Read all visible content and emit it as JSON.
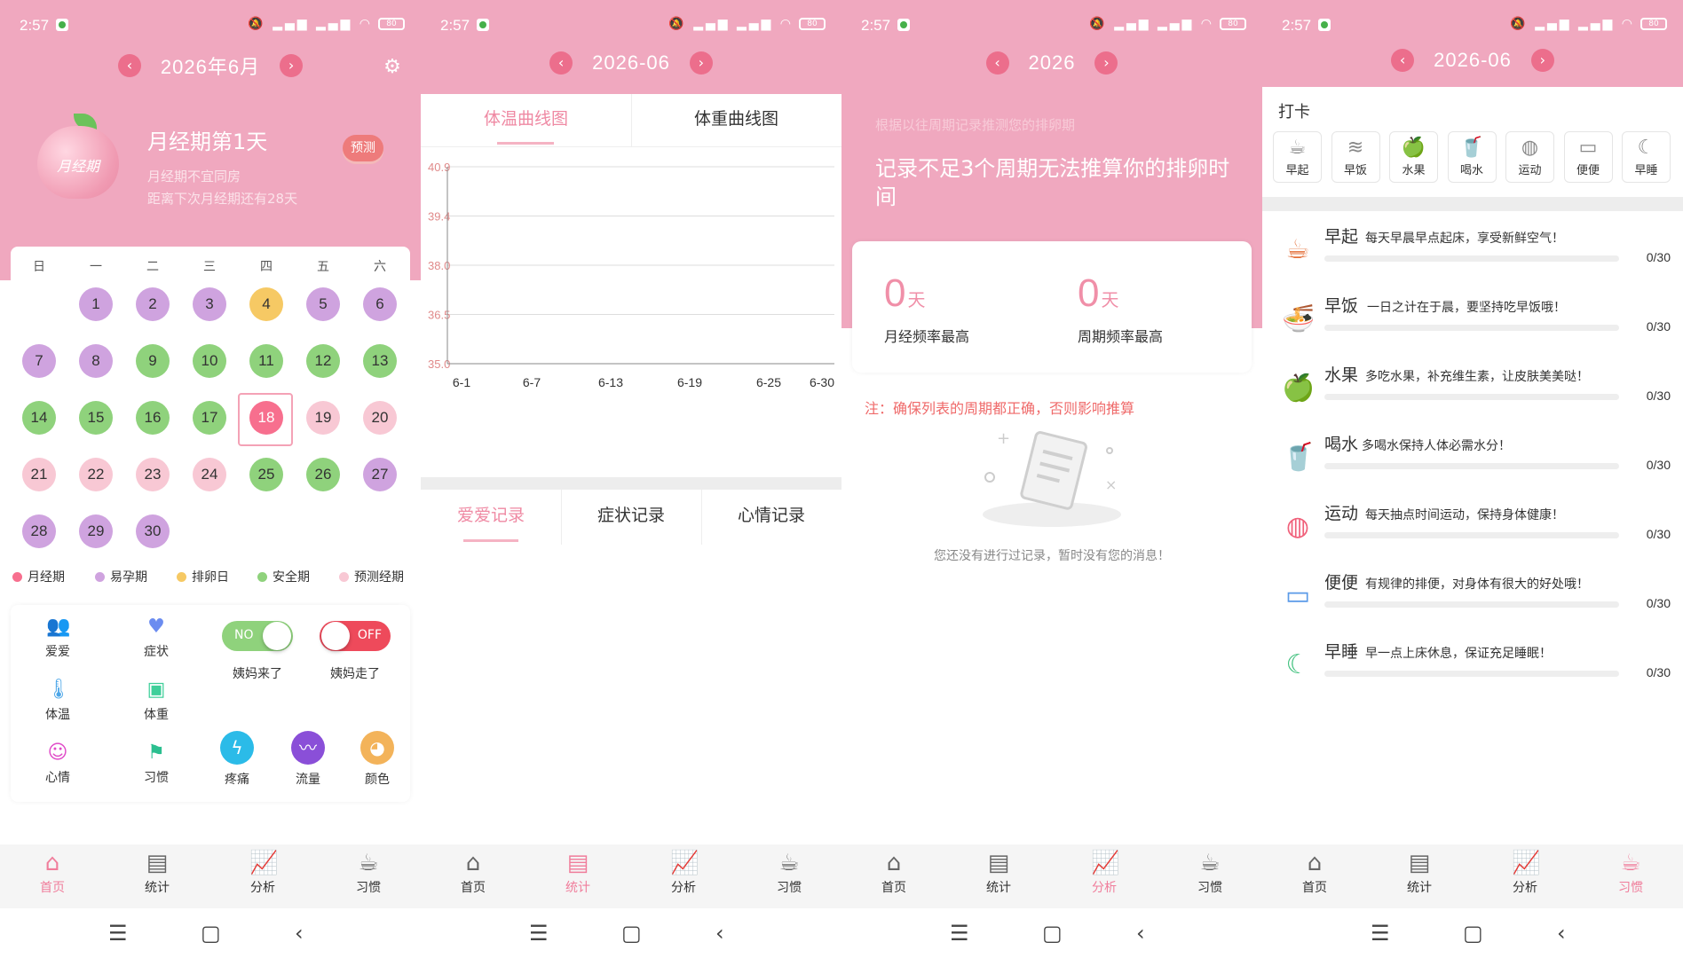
{
  "status": {
    "time": "2:57",
    "battery": "80"
  },
  "p1": {
    "month": "2026年6月",
    "apple_label": "月经期",
    "phase": "月经期第1天",
    "tip1": "月经期不宜同房",
    "tip2": "距离下次月经期还有28天",
    "predict": "预测",
    "weekdays": [
      "日",
      "一",
      "二",
      "三",
      "四",
      "五",
      "六"
    ],
    "days": [
      "1",
      "2",
      "3",
      "4",
      "5",
      "6",
      "7",
      "8",
      "9",
      "10",
      "11",
      "12",
      "13",
      "14",
      "15",
      "16",
      "17",
      "18",
      "19",
      "20",
      "21",
      "22",
      "23",
      "24",
      "25",
      "26",
      "27",
      "28",
      "29",
      "30"
    ],
    "legend": [
      "月经期",
      "易孕期",
      "排卵日",
      "安全期",
      "预测经期"
    ],
    "colors": {
      "mens": "#f76f8e",
      "fert": "#cfa3df",
      "ovu": "#f6c964",
      "safe": "#8fd27c",
      "pred": "#f8c8d4"
    },
    "tools": {
      "love": "爱爱",
      "symptom": "症状",
      "temp": "体温",
      "weight": "体重",
      "mood": "心情",
      "habit": "习惯",
      "pain": "疼痛",
      "flow": "流量",
      "color": "颜色"
    },
    "toggle_on": {
      "text": "NO",
      "label": "姨妈来了"
    },
    "toggle_off": {
      "text": "OFF",
      "label": "姨妈走了"
    }
  },
  "p2": {
    "month": "2026-06",
    "tab_temp": "体温曲线图",
    "tab_weight": "体重曲线图",
    "tab_love": "爱爱记录",
    "tab_symptom": "症状记录",
    "tab_mood": "心情记录"
  },
  "chart_data": {
    "type": "line",
    "title": "",
    "xlabel": "",
    "ylabel": "",
    "x": [
      "6-1",
      "6-7",
      "6-13",
      "6-19",
      "6-25",
      "6-30"
    ],
    "y_ticks": [
      "40.9",
      "39.4",
      "38.0",
      "36.5",
      "35.0"
    ],
    "ylim": [
      35.0,
      40.9
    ],
    "series": [],
    "grid": true
  },
  "p3": {
    "year": "2026",
    "hint": "根据以往周期记录推测您的排卵期",
    "message": "记录不足3个周期无法推算你的排卵时间",
    "stat1": {
      "num": "0",
      "unit": "天",
      "label": "月经频率最高"
    },
    "stat2": {
      "num": "0",
      "unit": "天",
      "label": "周期频率最高"
    },
    "note": "注：确保列表的周期都正确，否则影响推算",
    "empty": "您还没有进行过记录，暂时没有您的消息！"
  },
  "p4": {
    "month": "2026-06",
    "checkin_title": "打卡",
    "quick": [
      "早起",
      "早饭",
      "水果",
      "喝水",
      "运动",
      "便便",
      "早睡"
    ],
    "habits": [
      {
        "title": "早起",
        "desc": "每天早晨早点起床，享受新鲜空气！",
        "count": "0/30",
        "progress": 0
      },
      {
        "title": "早饭",
        "desc": "一日之计在于晨，要坚持吃早饭哦！",
        "count": "0/30",
        "progress": 0
      },
      {
        "title": "水果",
        "desc": "多吃水果，补充维生素，让皮肤美美哒！",
        "count": "0/30",
        "progress": 0
      },
      {
        "title": "喝水",
        "desc": "多喝水保持人体必需水分！",
        "count": "0/30",
        "progress": 0
      },
      {
        "title": "运动",
        "desc": "每天抽点时间运动，保持身体健康！",
        "count": "0/30",
        "progress": 0
      },
      {
        "title": "便便",
        "desc": "有规律的排便，对身体有很大的好处哦！",
        "count": "0/30",
        "progress": 0
      },
      {
        "title": "早睡",
        "desc": "早一点上床休息，保证充足睡眠！",
        "count": "0/30",
        "progress": 0
      }
    ]
  },
  "tabbar": {
    "home": "首页",
    "stats": "统计",
    "analysis": "分析",
    "habit": "习惯"
  }
}
